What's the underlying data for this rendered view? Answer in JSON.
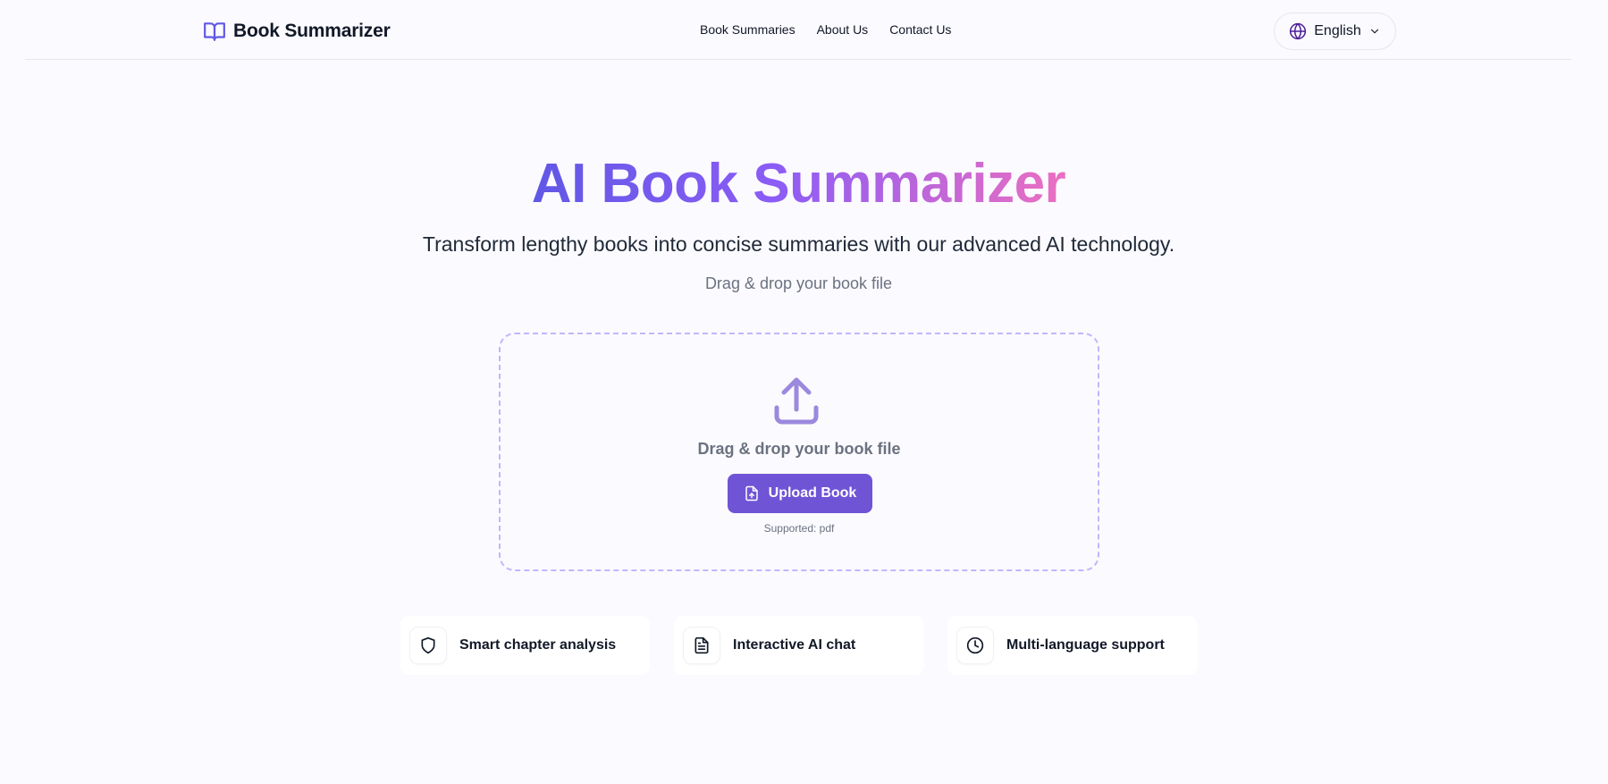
{
  "header": {
    "brand": "Book Summarizer",
    "nav": [
      "Book Summaries",
      "About Us",
      "Contact Us"
    ],
    "language": "English"
  },
  "hero": {
    "title": "AI Book Summarizer",
    "subtitle": "Transform lengthy books into concise summaries with our advanced AI technology.",
    "hint": "Drag & drop your book file"
  },
  "dropzone": {
    "text": "Drag & drop your book file",
    "button_label": "Upload Book",
    "supported": "Supported: pdf"
  },
  "features": [
    {
      "label": "Smart chapter analysis",
      "icon": "shield-icon"
    },
    {
      "label": "Interactive AI chat",
      "icon": "document-icon"
    },
    {
      "label": "Multi-language support",
      "icon": "clock-icon"
    }
  ],
  "colors": {
    "accent": "#6f54d6",
    "gradient_start": "#6158e5",
    "gradient_end": "#ec6fc0",
    "background": "#fbfaff"
  }
}
